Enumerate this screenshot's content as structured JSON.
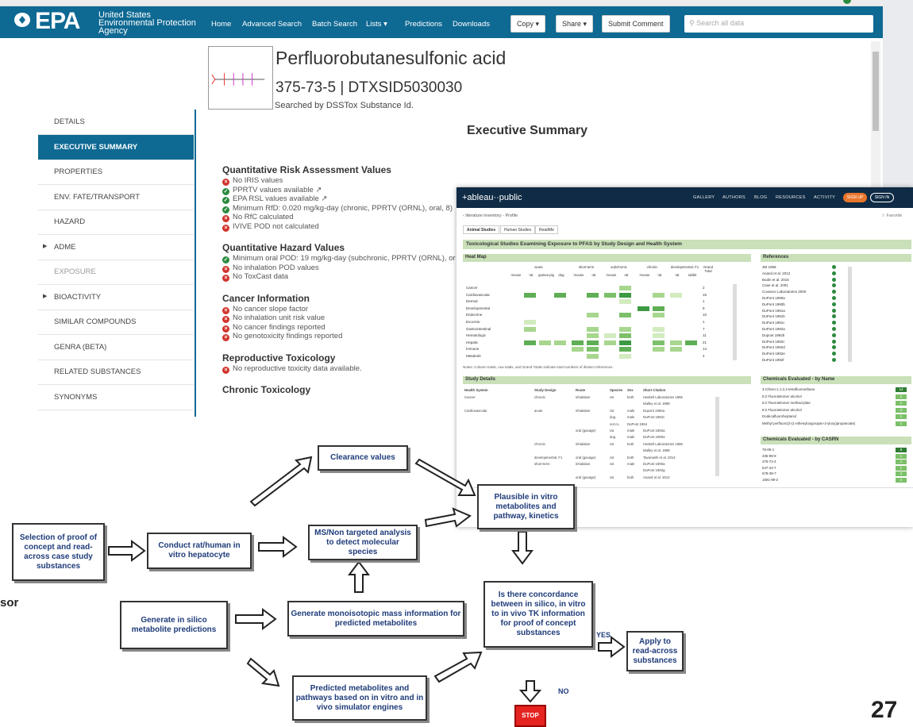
{
  "epa": {
    "logo": "EPA",
    "agency_lines": [
      "United States",
      "Environmental Protection",
      "Agency"
    ],
    "nav": [
      "Home",
      "Advanced Search",
      "Batch Search",
      "Lists ▾",
      "Predictions",
      "Downloads"
    ],
    "buttons": {
      "copy": "Copy ▾",
      "share": "Share ▾",
      "submit": "Submit Comment"
    },
    "search_placeholder": "Search all data",
    "chem_name": "Perfluorobutanesulfonic acid",
    "chem_id": "375-73-5 | DTXSID5030030",
    "searched_by": "Searched by DSSTox Substance Id.",
    "sidebar": [
      {
        "label": "DETAILS",
        "state": "normal"
      },
      {
        "label": "EXECUTIVE SUMMARY",
        "state": "active"
      },
      {
        "label": "PROPERTIES",
        "state": "normal"
      },
      {
        "label": "ENV. FATE/TRANSPORT",
        "state": "normal"
      },
      {
        "label": "HAZARD",
        "state": "normal"
      },
      {
        "label": "ADME",
        "state": "expand"
      },
      {
        "label": "EXPOSURE",
        "state": "muted"
      },
      {
        "label": "BIOACTIVITY",
        "state": "expand"
      },
      {
        "label": "SIMILAR COMPOUNDS",
        "state": "normal"
      },
      {
        "label": "GENRA (BETA)",
        "state": "normal"
      },
      {
        "label": "RELATED SUBSTANCES",
        "state": "normal"
      },
      {
        "label": "SYNONYMS",
        "state": "normal"
      }
    ],
    "exec_title": "Executive Summary",
    "sections": [
      {
        "title": "Quantitative Risk Assessment Values",
        "lines": [
          {
            "status": "no",
            "text": "No IRIS values"
          },
          {
            "status": "ok",
            "text": "PPRTV values available ↗"
          },
          {
            "status": "ok",
            "text": "EPA RSL values available ↗"
          },
          {
            "status": "ok",
            "text": "Minimum RfD: 0.020 mg/kg-day (chronic, PPRTV (ORNL), oral, 8)"
          },
          {
            "status": "no",
            "text": "No RfC calculated"
          },
          {
            "status": "no",
            "text": "IVIVE POD not calculated"
          }
        ]
      },
      {
        "title": "Quantitative Hazard Values",
        "lines": [
          {
            "status": "ok",
            "text": "Minimum oral POD: 19 mg/kg-day (subchronic, PPRTV (ORNL), or"
          },
          {
            "status": "no",
            "text": "No inhalation POD values"
          },
          {
            "status": "no",
            "text": "No ToxCast data"
          }
        ]
      },
      {
        "title": "Cancer Information",
        "lines": [
          {
            "status": "no",
            "text": "No cancer slope factor"
          },
          {
            "status": "no",
            "text": "No inhalation unit risk value"
          },
          {
            "status": "no",
            "text": "No cancer findings reported"
          },
          {
            "status": "no",
            "text": "No genotoxicity findings reported"
          }
        ]
      },
      {
        "title": "Reproductive Toxicology",
        "lines": [
          {
            "status": "no",
            "text": "No reproductive toxicity data available."
          }
        ]
      },
      {
        "title": "Chronic Toxicology",
        "lines": []
      }
    ]
  },
  "tableau": {
    "logo": "+ableau··public",
    "nav": [
      "GALLERY",
      "AUTHORS",
      "BLOG",
      "RESOURCES",
      "ACTIVITY"
    ],
    "signup": "SIGN UP",
    "signin": "SIGN IN",
    "crumb": "‹ literature inventory - Profile",
    "favorite": "☆ Favorite",
    "tabs": [
      "Animal Studies",
      "Human Studies",
      "ReadMe"
    ],
    "title": "Toxicological Studies Examining Exposure to PFAS by Study Design and Health System",
    "heatmap_head": "Heat Map",
    "references_head": "References",
    "study_head": "Study Details",
    "chem_name_head": "Chemicals Evaluated - by Name",
    "chem_cas_head": "Chemicals Evaluated - by CASRN",
    "col_groups": [
      "acute",
      "short-term",
      "subchronic",
      "chronic",
      "developmental, F1",
      "Grand Total"
    ],
    "col_species": [
      "mouse",
      "rat",
      "guinea pig",
      "dog",
      "mouse",
      "rat",
      "mouse",
      "rat",
      "mouse",
      "rat",
      "rat",
      "rabbit"
    ],
    "rows": [
      "Cancer",
      "Cardiovascular",
      "Dermal",
      "Developmental",
      "Endocrine",
      "Exocrine",
      "Gastrointestinal",
      "Hematologic",
      "Hepatic",
      "Immune",
      "Metabolic"
    ],
    "totals": [
      "2",
      "15",
      "1",
      "9",
      "10",
      "1",
      "7",
      "11",
      "21",
      "14",
      "4"
    ],
    "references": [
      "3M 1999",
      "Anand et al. 2012",
      "Bodin et al. 2016",
      "Case et al. 2001",
      "Covance Laboratories 2000",
      "DuPont 1990a",
      "DuPont 1990b",
      "DuPont 1991a",
      "DuPont 1991b",
      "DuPont 1991c",
      "DuPont 1992a",
      "Dupont 1992b",
      "DuPont 1992c",
      "DuPont 1992d",
      "DuPont 1992e",
      "DuPont 1992f"
    ],
    "notes": "Notes: Column totals, row totals, and Grand Totals indicate total numbers of distinct references.",
    "study_cols": [
      "Health System",
      "Study Design",
      "Route",
      "Species",
      "Sex",
      "Short Citation"
    ],
    "study_rows": [
      [
        "Cancer",
        "chronic",
        "inhalation",
        "rat",
        "both",
        "Haskell Laboratories 1986"
      ],
      [
        "",
        "",
        "",
        "",
        "",
        "Malley et al. 1998"
      ],
      [
        "Cardiovascular",
        "acute",
        "inhalation",
        "rat",
        "male",
        "Dupont 1992a"
      ],
      [
        "",
        "",
        "",
        "dog",
        "male",
        "DuPont 1992c"
      ],
      [
        "",
        "",
        "",
        "not re..",
        "DuPont 1994",
        ""
      ],
      [
        "",
        "",
        "oral (gavage)",
        "rat",
        "male",
        "DuPont 1992a"
      ],
      [
        "",
        "",
        "",
        "dog",
        "male",
        "DuPont 1990a"
      ],
      [
        "",
        "chronic",
        "inhalation",
        "rat",
        "both",
        "Haskell Laboratories 1986"
      ],
      [
        "",
        "",
        "",
        "",
        "",
        "Malley et al. 1998"
      ],
      [
        "",
        "developmental, F1",
        "oral (gavage)",
        "rat",
        "both",
        "Tavanashi et al. 2014"
      ],
      [
        "",
        "short-term",
        "inhalation",
        "rat",
        "male",
        "DuPont 1990a"
      ],
      [
        "",
        "",
        "",
        "",
        "",
        "DuPont 1992g"
      ],
      [
        "",
        "",
        "oral (gavage)",
        "rat",
        "both",
        "Anand et al. 2012"
      ]
    ],
    "chem_names": [
      {
        "name": "3-Chloro-1,1,2,2-tetrafluoroethane",
        "v": "14"
      },
      {
        "name": "6:2 Fluorotelomer alcohol",
        "v": "2"
      },
      {
        "name": "6:2 Fluorotelomer methacrylate",
        "v": "1"
      },
      {
        "name": "8:2 Fluorotelomer alcohol",
        "v": "3"
      },
      {
        "name": "Dodecafluoroheptanol",
        "v": "1"
      },
      {
        "name": "Methyl perfluoro(3-(1-ethenyloxypropan-2-yloxy)propanoate)",
        "v": "1"
      }
    ],
    "chem_cas": [
      {
        "name": "76-05-1",
        "v": "8"
      },
      {
        "name": "335-99-9",
        "v": "1"
      },
      {
        "name": "375-72-4",
        "v": "2"
      },
      {
        "name": "647-42-7",
        "v": "1"
      },
      {
        "name": "678-39-7",
        "v": "3"
      },
      {
        "name": "1691-99-2",
        "v": "2"
      }
    ],
    "footer": "⦿ + ← → ⇥ ⇄ ⬜ ⤢"
  },
  "flow": {
    "clearance": "Clearance values",
    "selection": "Selection of proof of concept and read-across case study substances",
    "conduct": "Conduct rat/human in vitro hepatocyte",
    "ms": "MS/Non targeted analysis to detect molecular species",
    "plausible": "Plausible in vitro metabolites and pathway, kinetics",
    "generate_insilico": "Generate in silico metabolite predictions",
    "generate_mono": "Generate monoisotopic mass information for predicted metabolites",
    "concordance": "Is there concordance between in silico, in vitro to in vivo TK information for proof of concept substances",
    "apply": "Apply to read-across substances",
    "predicted": "Predicted metabolites and pathways based on in vitro and in vivo simulator engines",
    "yes": "YES",
    "no": "NO",
    "stop": "STOP"
  },
  "slide": {
    "page": "27",
    "partial_text": "sor"
  }
}
